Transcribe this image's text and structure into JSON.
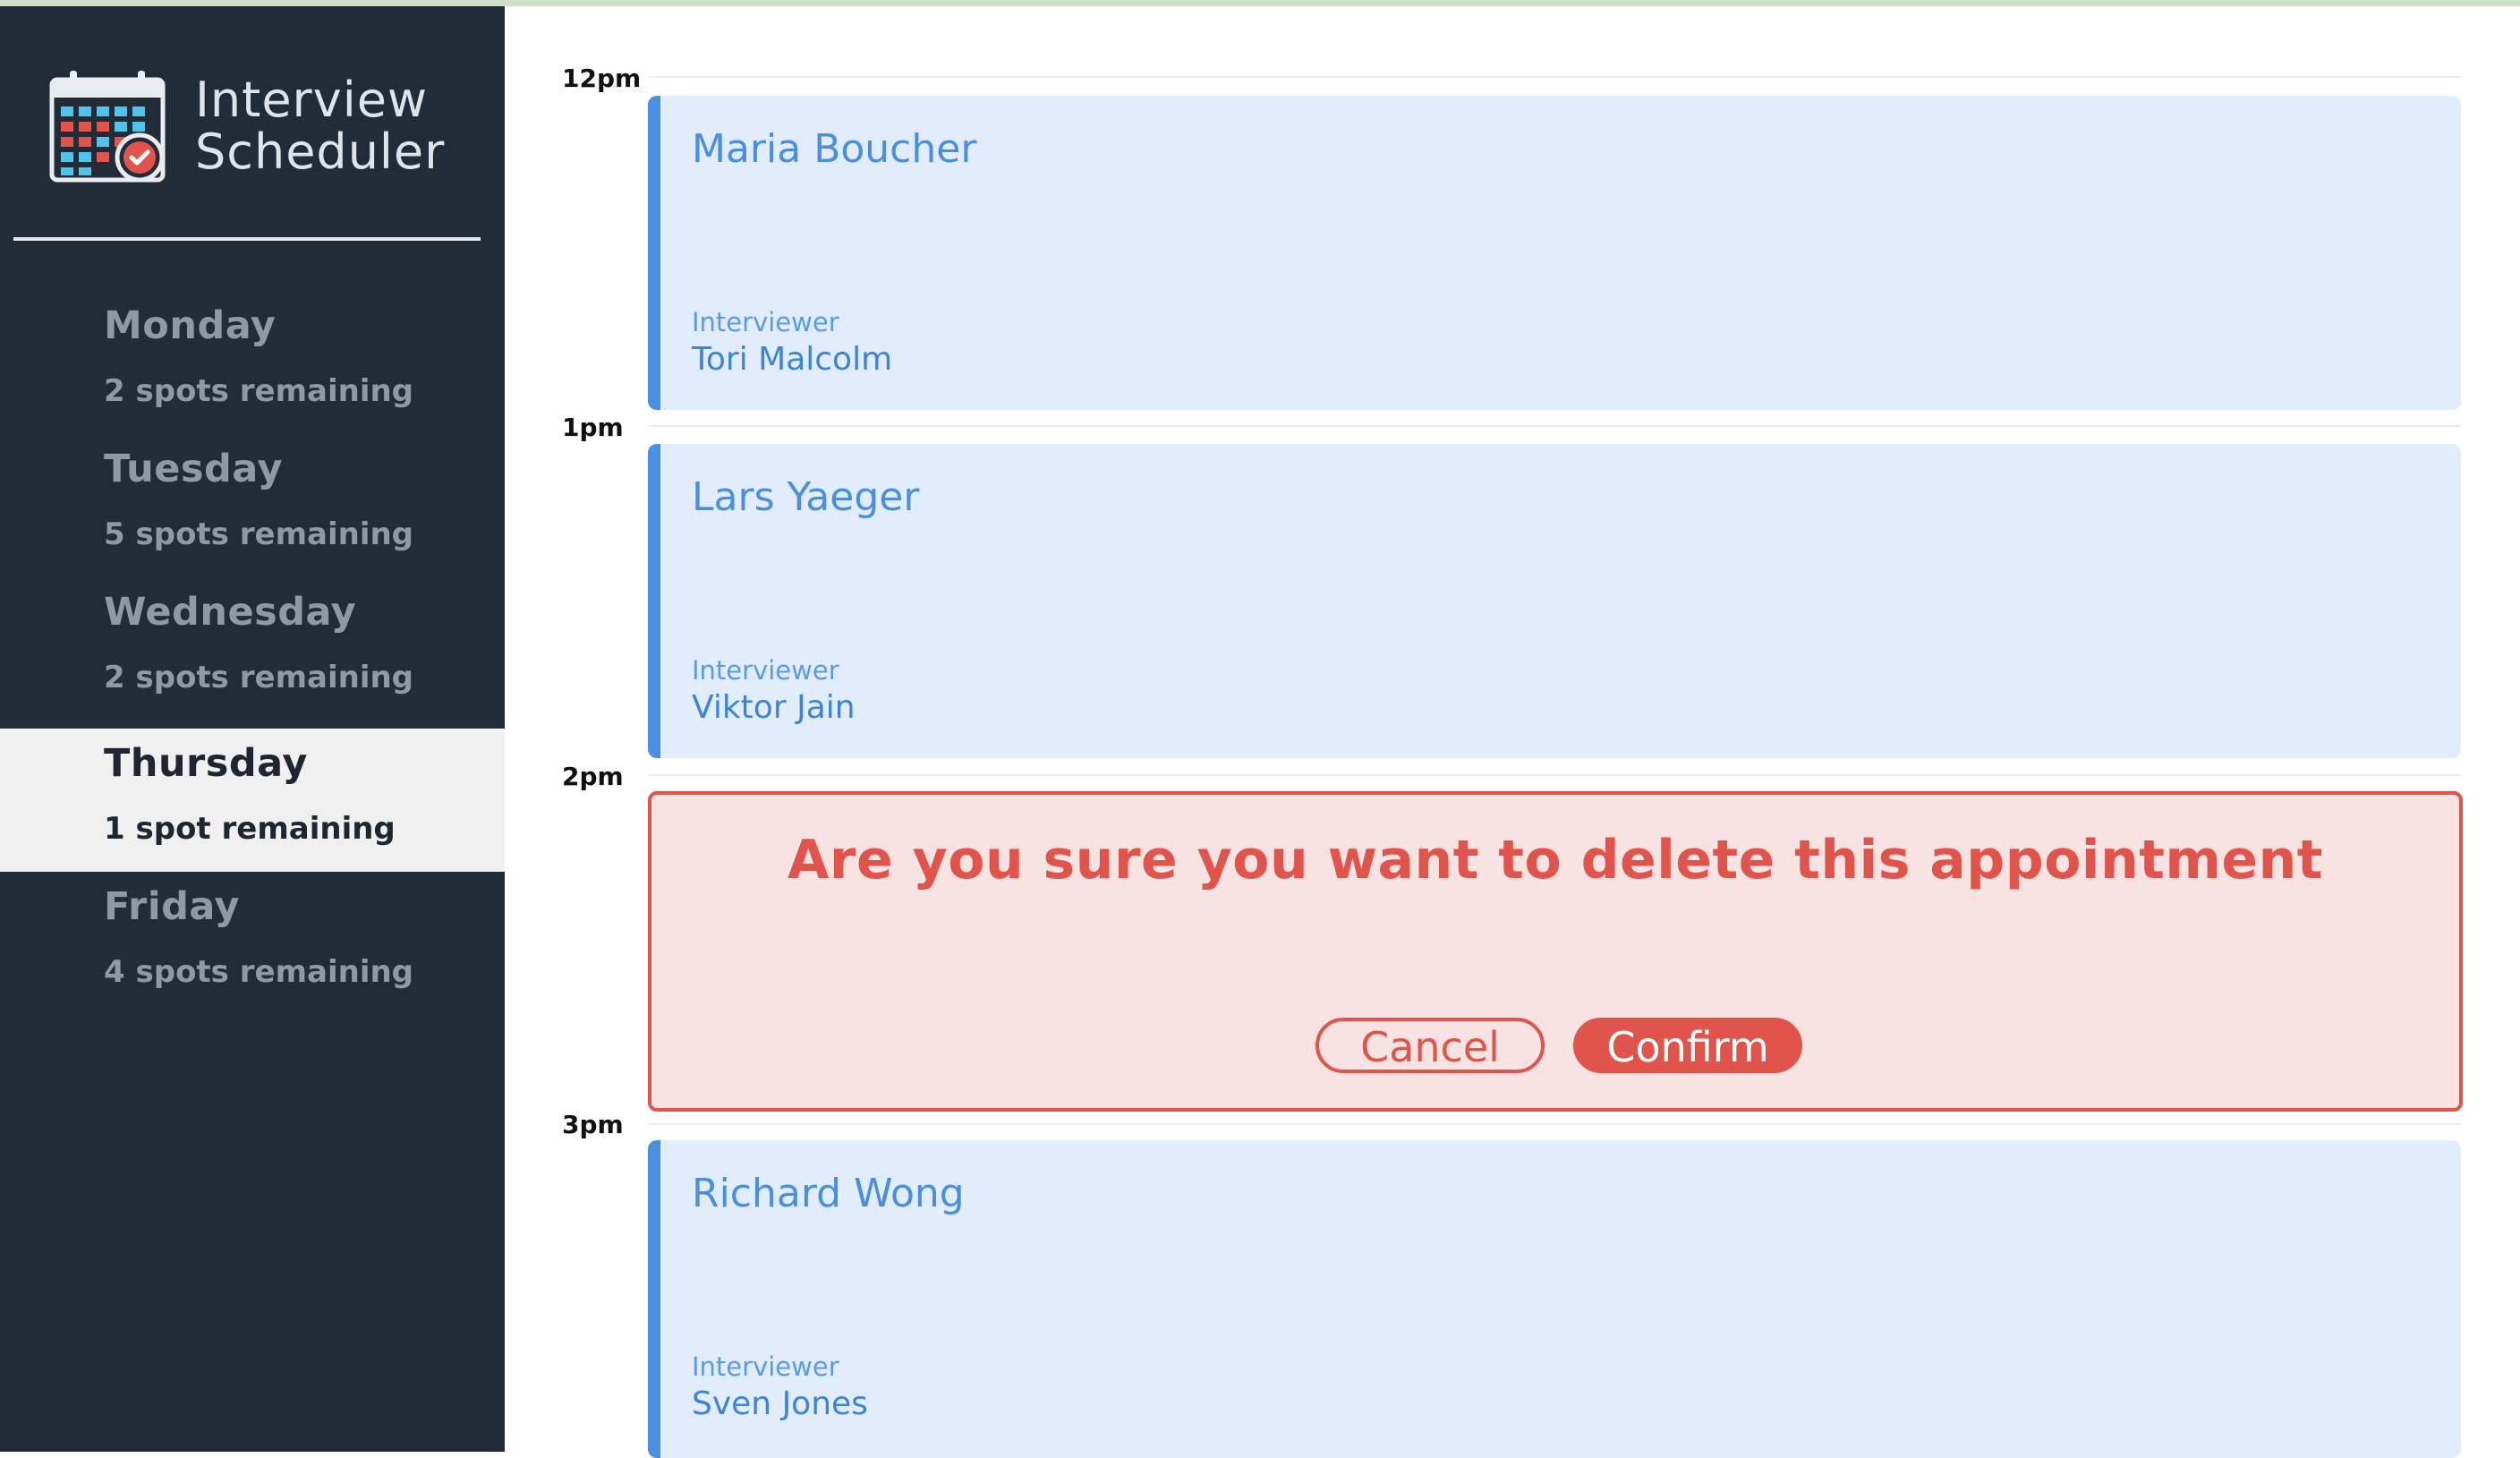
{
  "app": {
    "title_line1": "Interview",
    "title_line2": "Scheduler"
  },
  "colors": {
    "sidebar": "#222b38",
    "accent": "#4a90e2",
    "danger": "#e0544b",
    "appointment_bg": "#e1edfc"
  },
  "days": [
    {
      "name": "Monday",
      "spots": "2 spots remaining",
      "selected": false
    },
    {
      "name": "Tuesday",
      "spots": "5 spots remaining",
      "selected": false
    },
    {
      "name": "Wednesday",
      "spots": "2 spots remaining",
      "selected": false
    },
    {
      "name": "Thursday",
      "spots": "1 spot remaining",
      "selected": true
    },
    {
      "name": "Friday",
      "spots": "4 spots remaining",
      "selected": false
    }
  ],
  "times": [
    "12pm",
    "1pm",
    "2pm",
    "3pm"
  ],
  "appointments": [
    {
      "student": "Maria Boucher",
      "interviewer_label": "Interviewer",
      "interviewer": "Tori Malcolm"
    },
    {
      "student": "Lars Yaeger",
      "interviewer_label": "Interviewer",
      "interviewer": "Viktor Jain"
    },
    {
      "student": "Richard Wong",
      "interviewer_label": "Interviewer",
      "interviewer": "Sven Jones"
    }
  ],
  "confirm": {
    "message": "Are you sure you want to delete this appointment",
    "cancel_label": "Cancel",
    "confirm_label": "Confirm"
  },
  "icons": {
    "logo": "calendar-check-icon"
  }
}
